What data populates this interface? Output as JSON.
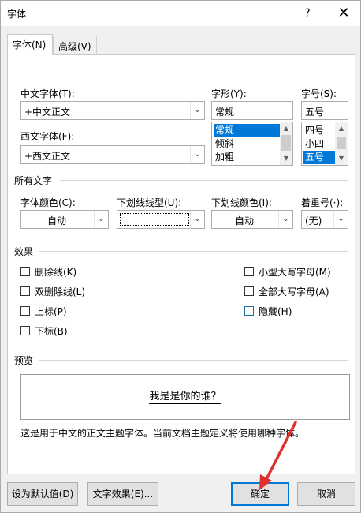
{
  "window": {
    "title": "字体",
    "help_glyph": "?",
    "close_glyph": "✕"
  },
  "tabs": [
    {
      "label": "字体(N)",
      "active": true
    },
    {
      "label": "高级(V)",
      "active": false
    }
  ],
  "font": {
    "cn_font_label": "中文字体(T):",
    "cn_font_value": "+中文正文",
    "west_font_label": "西文字体(F):",
    "west_font_value": "+西文正文",
    "style_label": "字形(Y):",
    "style_value": "常规",
    "style_options": [
      "常规",
      "倾斜",
      "加粗"
    ],
    "size_label": "字号(S):",
    "size_value": "五号",
    "size_options": [
      "四号",
      "小四",
      "五号"
    ]
  },
  "all_text": {
    "section": "所有文字",
    "color_label": "字体颜色(C):",
    "color_value": "自动",
    "underline_style_label": "下划线线型(U):",
    "underline_style_value": "",
    "underline_color_label": "下划线颜色(I):",
    "underline_color_value": "自动",
    "emphasis_label": "着重号(·):",
    "emphasis_value": "(无)"
  },
  "effects": {
    "section": "效果",
    "left": [
      "删除线(K)",
      "双删除线(L)",
      "上标(P)",
      "下标(B)"
    ],
    "right": [
      "小型大写字母(M)",
      "全部大写字母(A)",
      "隐藏(H)"
    ]
  },
  "preview": {
    "section": "预览",
    "sample": "我是是你的谁？",
    "description": "这是用于中文的正文主题字体。当前文档主题定义将使用哪种字体。"
  },
  "buttons": {
    "set_default": "设为默认值(D)",
    "text_effects": "文字效果(E)...",
    "ok": "确定",
    "cancel": "取消"
  },
  "colors": {
    "accent": "#0078d7",
    "annotation": "#e0302a"
  }
}
